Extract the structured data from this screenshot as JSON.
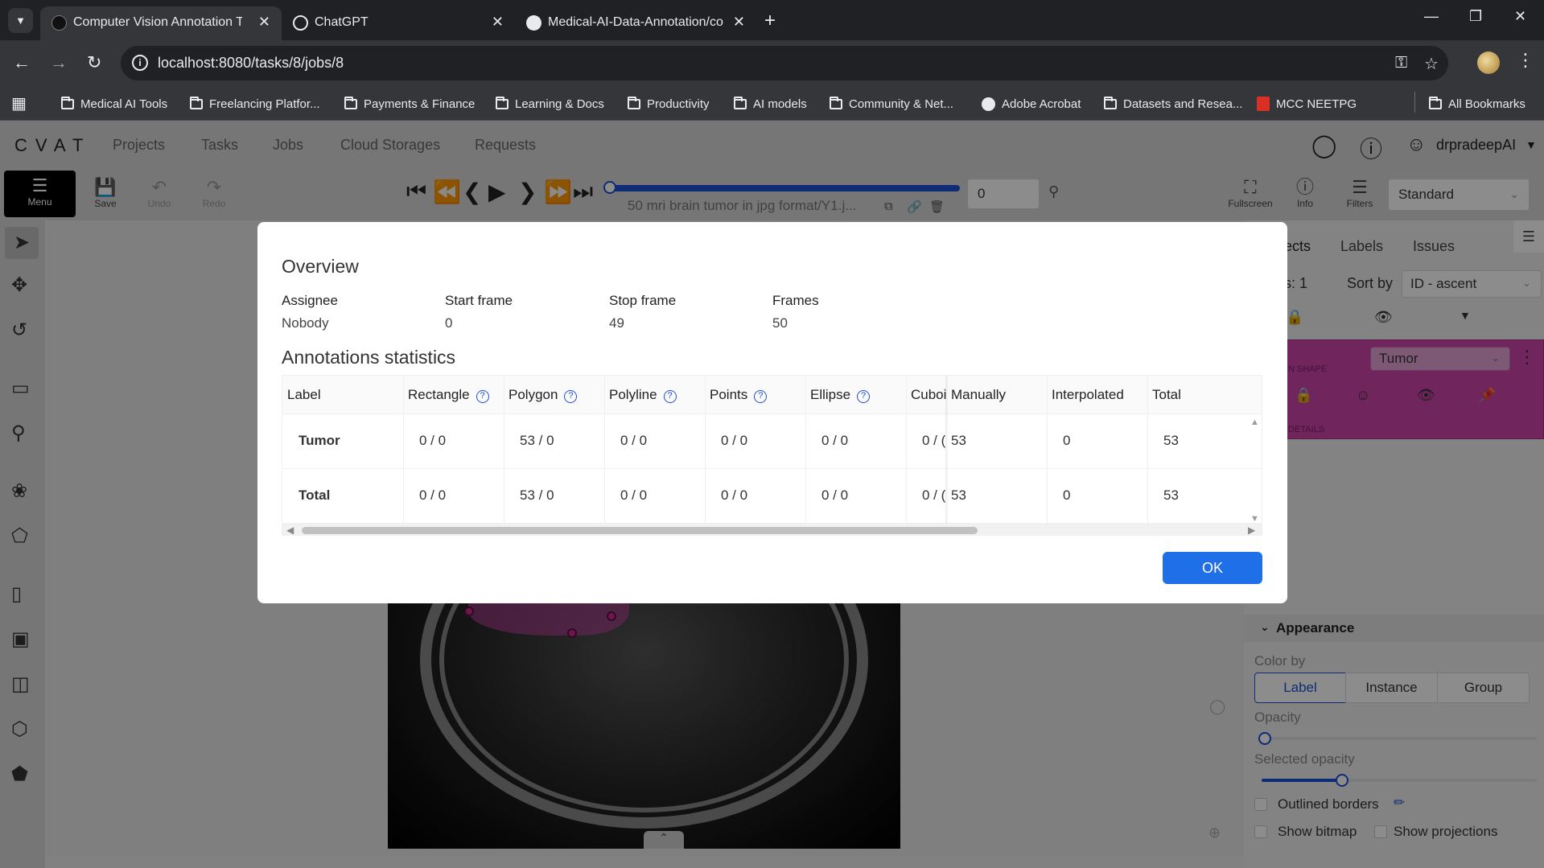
{
  "browser": {
    "tabs": [
      {
        "title": "Computer Vision Annotation To",
        "active": true,
        "icon": "cvat-favicon"
      },
      {
        "title": "ChatGPT",
        "active": false,
        "icon": "chatgpt-favicon"
      },
      {
        "title": "Medical-AI-Data-Annotation/co",
        "active": false,
        "icon": "github-favicon"
      }
    ],
    "url": "localhost:8080/tasks/8/jobs/8",
    "bookmarks": [
      {
        "label": "Medical AI Tools",
        "icon": "folder-icon"
      },
      {
        "label": "Freelancing Platfor...",
        "icon": "folder-icon"
      },
      {
        "label": "Payments & Finance",
        "icon": "folder-icon"
      },
      {
        "label": "Learning & Docs",
        "icon": "folder-icon"
      },
      {
        "label": "Productivity",
        "icon": "folder-icon"
      },
      {
        "label": "AI models",
        "icon": "folder-icon"
      },
      {
        "label": "Community & Net...",
        "icon": "folder-icon"
      },
      {
        "label": "Adobe Acrobat",
        "icon": "acrobat-icon"
      },
      {
        "label": "Datasets and Resea...",
        "icon": "folder-icon"
      },
      {
        "label": "MCC NEETPG",
        "icon": "mcc-icon"
      }
    ],
    "all_bookmarks": "All Bookmarks"
  },
  "header": {
    "logo": "CVAT",
    "nav": [
      "Projects",
      "Tasks",
      "Jobs",
      "Cloud Storages",
      "Requests"
    ],
    "username": "drpradeepAI"
  },
  "toolbar": {
    "menu_label": "Menu",
    "save_label": "Save",
    "undo_label": "Undo",
    "redo_label": "Redo",
    "frame_name": "50 mri brain tumor in jpg format/Y1.j...",
    "frame_number": "0",
    "fullscreen_label": "Fullscreen",
    "info_label": "Info",
    "filters_label": "Filters",
    "workspace": "Standard"
  },
  "sidebar": {
    "tabs": [
      "ects",
      "Labels",
      "Issues"
    ],
    "count_text": "s: 1",
    "sort_label": "Sort by",
    "sort_value": "ID - ascent",
    "object": {
      "kind": "N SHAPE",
      "details": "DETAILS",
      "label": "Tumor",
      "color": "#cc44aa"
    },
    "appearance": {
      "title": "Appearance",
      "color_by_label": "Color by",
      "color_by_options": [
        "Label",
        "Instance",
        "Group"
      ],
      "color_by_selected": "Label",
      "opacity_label": "Opacity",
      "selected_opacity_label": "Selected opacity",
      "outlined_borders_label": "Outlined borders",
      "show_bitmap_label": "Show bitmap",
      "show_projections_label": "Show projections"
    }
  },
  "modal": {
    "overview_title": "Overview",
    "meta": [
      {
        "key": "Assignee",
        "value": "Nobody"
      },
      {
        "key": "Start frame",
        "value": "0"
      },
      {
        "key": "Stop frame",
        "value": "49"
      },
      {
        "key": "Frames",
        "value": "50"
      }
    ],
    "stats_title": "Annotations statistics",
    "columns": [
      "Label",
      "Rectangle",
      "Polygon",
      "Polyline",
      "Points",
      "Ellipse",
      "Cuboi",
      "Manually",
      "Interpolated",
      "Total"
    ],
    "rows": [
      {
        "label": "Tumor",
        "values": [
          "0 / 0",
          "53 / 0",
          "0 / 0",
          "0 / 0",
          "0 / 0",
          "0 / (",
          "53",
          "0",
          "53"
        ]
      },
      {
        "label": "Total",
        "values": [
          "0 / 0",
          "53 / 0",
          "0 / 0",
          "0 / 0",
          "0 / 0",
          "0 / (",
          "53",
          "0",
          "53"
        ]
      }
    ],
    "ok_label": "OK"
  }
}
